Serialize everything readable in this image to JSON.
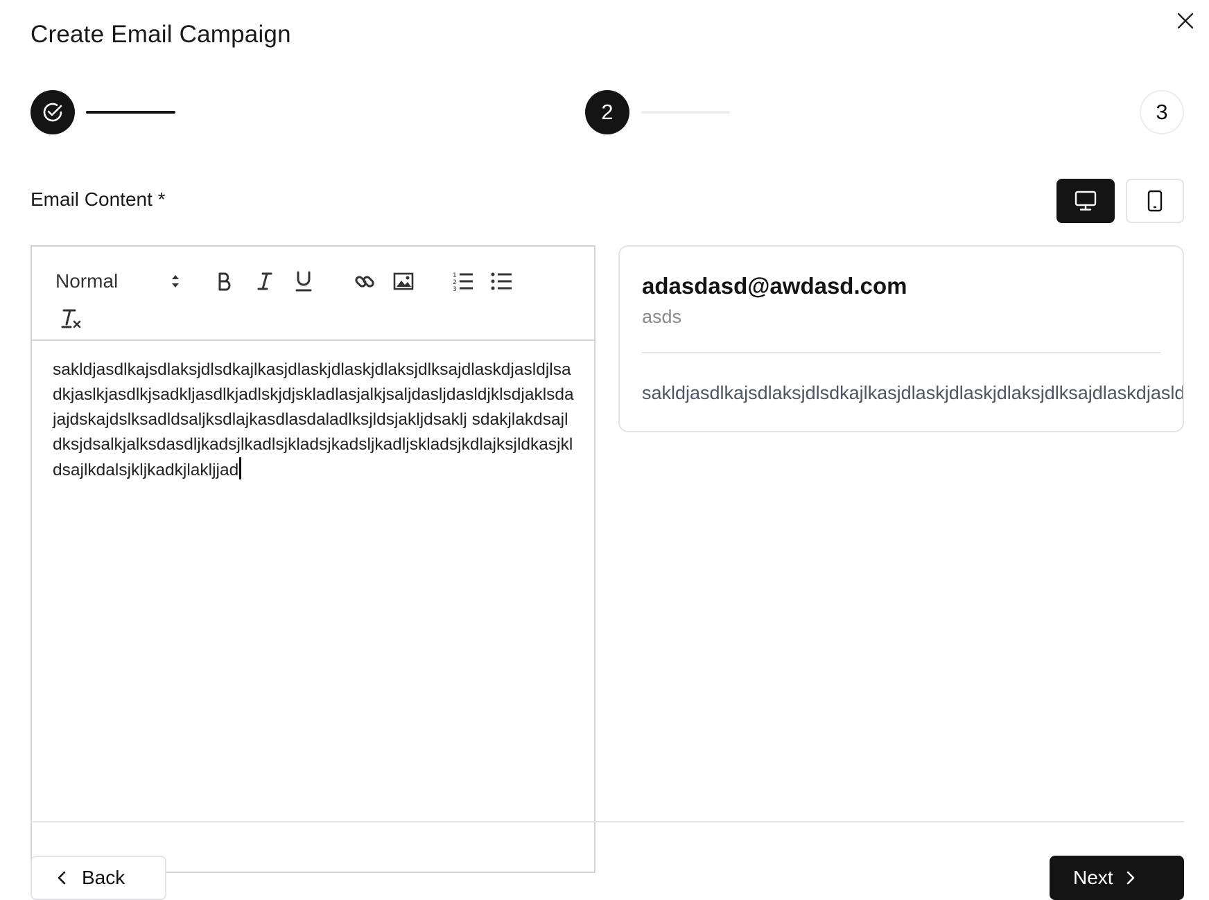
{
  "dialog": {
    "title": "Create Email Campaign"
  },
  "stepper": {
    "steps": [
      {
        "label": "",
        "state": "completed",
        "icon": "check-circle-icon"
      },
      {
        "label": "2",
        "state": "active"
      },
      {
        "label": "3",
        "state": "upcoming"
      }
    ]
  },
  "content_section": {
    "label": "Email Content *",
    "view_modes": [
      {
        "name": "desktop",
        "icon": "monitor-icon",
        "selected": true
      },
      {
        "name": "mobile",
        "icon": "smartphone-icon",
        "selected": false
      }
    ]
  },
  "editor": {
    "format_value": "Normal",
    "toolbar_icons": [
      "bold-icon",
      "italic-icon",
      "underline-icon",
      "link-icon",
      "image-icon",
      "ordered-list-icon",
      "bullet-list-icon",
      "clear-format-icon"
    ],
    "body_text": "sakldjasdlkajsdlaksjdlsdkajlkasjdlaskjdlaskjdlaksjdlksajdlaskdjasldjlsadkjaslkjasdlkjsadkljasdlkjadlskjdjskladlasjalkjsaljdasljdasldjklsdjaklsdajajdskajdslksadldsaljksdlajkasdlasdaladlksjldsjakljdsaklj sdakjlakdsajldksjdsalkjalksdasdljkadsjlkadlsjkladsjkadsljkadljskladsjkdlajksjldkasjkldsajlkdalsjkljkadkjlakljjad"
  },
  "preview": {
    "from": "adasdasd@awdasd.com",
    "subject": "asds",
    "body": "sakldjasdlkajsdlaksjdlsdkajlkasjdlaskjdlaskjdlaksjdlksajdlaskdjasldjlsadkjaslkjasdlkjsadkljasdlkjadlskjdjskladlasjalkjsaljdasljdasldjkl"
  },
  "footer": {
    "back_label": "Back",
    "next_label": "Next"
  },
  "colors": {
    "primary": "#141414",
    "border": "#e4e4e7",
    "muted_text": "#8a8a8a"
  }
}
